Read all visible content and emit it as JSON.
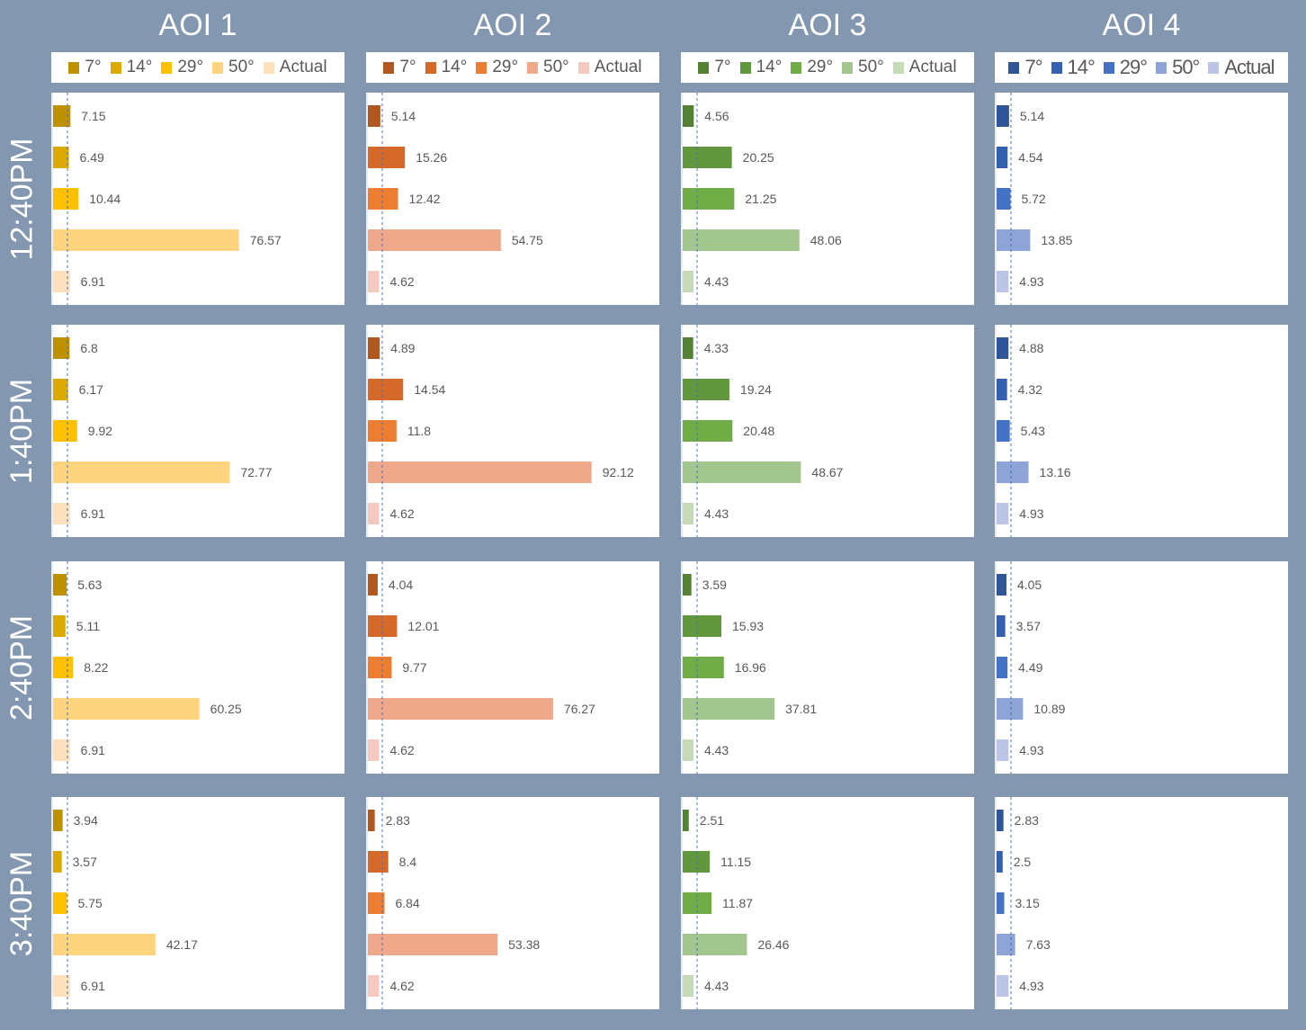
{
  "columns": [
    "AOI 1",
    "AOI 2",
    "AOI 3",
    "AOI 4"
  ],
  "rows": [
    "12:40PM",
    "1:40PM",
    "2:40PM",
    "3:40PM"
  ],
  "legend_labels": [
    "7°",
    "14°",
    "29°",
    "50°",
    "Actual"
  ],
  "colors": {
    "background": "#8497b0",
    "AOI 1": [
      "#bf9000",
      "#dba900",
      "#ffc000",
      "#ffd47f",
      "#fde0bc"
    ],
    "AOI 2": [
      "#b0581f",
      "#d4692a",
      "#ed7d31",
      "#f0a88a",
      "#f5c9c0"
    ],
    "AOI 3": [
      "#548235",
      "#61983e",
      "#70ad47",
      "#a3c68e",
      "#c5dbb7"
    ],
    "AOI 4": [
      "#2f5597",
      "#3560b0",
      "#4472c4",
      "#8ea3d6",
      "#bcc5e6"
    ]
  },
  "chart_data": {
    "type": "bar",
    "orientation": "horizontal",
    "categories": [
      "7°",
      "14°",
      "29°",
      "50°",
      "Actual"
    ],
    "x_range": [
      0,
      100
    ],
    "grid": false,
    "legend": "top",
    "panels": [
      {
        "row": "12:40PM",
        "column": "AOI 1",
        "values": [
          7.15,
          6.49,
          10.44,
          76.57,
          6.91
        ]
      },
      {
        "row": "12:40PM",
        "column": "AOI 2",
        "values": [
          5.14,
          15.26,
          12.42,
          54.75,
          4.62
        ]
      },
      {
        "row": "12:40PM",
        "column": "AOI 3",
        "values": [
          4.56,
          20.25,
          21.25,
          48.06,
          4.43
        ]
      },
      {
        "row": "12:40PM",
        "column": "AOI 4",
        "values": [
          5.14,
          4.54,
          5.72,
          13.85,
          4.93
        ]
      },
      {
        "row": "1:40PM",
        "column": "AOI 1",
        "values": [
          6.8,
          6.17,
          9.92,
          72.77,
          6.91
        ]
      },
      {
        "row": "1:40PM",
        "column": "AOI 2",
        "values": [
          4.89,
          14.54,
          11.8,
          92.12,
          4.62
        ]
      },
      {
        "row": "1:40PM",
        "column": "AOI 3",
        "values": [
          4.33,
          19.24,
          20.48,
          48.67,
          4.43
        ]
      },
      {
        "row": "1:40PM",
        "column": "AOI 4",
        "values": [
          4.88,
          4.32,
          5.43,
          13.16,
          4.93
        ]
      },
      {
        "row": "2:40PM",
        "column": "AOI 1",
        "values": [
          5.63,
          5.11,
          8.22,
          60.25,
          6.91
        ]
      },
      {
        "row": "2:40PM",
        "column": "AOI 2",
        "values": [
          4.04,
          12.01,
          9.77,
          76.27,
          4.62
        ]
      },
      {
        "row": "2:40PM",
        "column": "AOI 3",
        "values": [
          3.59,
          15.93,
          16.96,
          37.81,
          4.43
        ]
      },
      {
        "row": "2:40PM",
        "column": "AOI 4",
        "values": [
          4.05,
          3.57,
          4.49,
          10.89,
          4.93
        ]
      },
      {
        "row": "3:40PM",
        "column": "AOI 1",
        "values": [
          3.94,
          3.57,
          5.75,
          42.17,
          6.91
        ]
      },
      {
        "row": "3:40PM",
        "column": "AOI 2",
        "values": [
          2.83,
          8.4,
          6.84,
          53.38,
          4.62
        ]
      },
      {
        "row": "3:40PM",
        "column": "AOI 3",
        "values": [
          2.51,
          11.15,
          11.87,
          26.46,
          4.43
        ]
      },
      {
        "row": "3:40PM",
        "column": "AOI 4",
        "values": [
          2.83,
          2.5,
          3.15,
          7.63,
          4.93
        ]
      }
    ]
  }
}
